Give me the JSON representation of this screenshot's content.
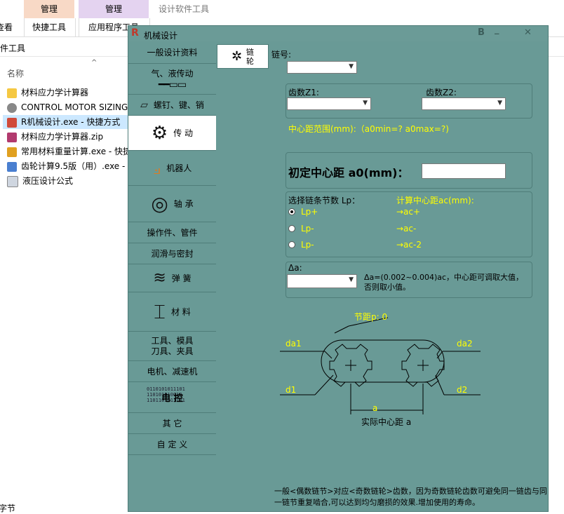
{
  "explorer": {
    "ribbon_tabs": [
      "管理",
      "管理"
    ],
    "ribbon_title": "设计软件工具",
    "ribbon_row": [
      "查看",
      "快捷工具",
      "应用程序工具"
    ],
    "address": "件工具",
    "column_name": "名称",
    "files": [
      "材料应力学计算器",
      "CONTROL MOTOR SIZING",
      "R机械设计.exe - 快捷方式",
      "材料应力学计算器.zip",
      "常用材料重量计算.exe - 快捷",
      "齿轮计算9.5版（用）.exe - ",
      "液压设计公式"
    ],
    "bottom_text": "字节"
  },
  "app": {
    "title": "机械设计",
    "title_controls": [
      "B",
      "_",
      "✕"
    ],
    "nav": [
      "一般设计资料",
      "气、液传动",
      "螺钉、键、销",
      "传 动",
      "机器人",
      "轴 承",
      "操作件、管件",
      "润滑与密封",
      "弹 簧",
      "材 料",
      "工具、模具\n刀具、夹具",
      "电机、减速机",
      "电 控",
      "其 它",
      "自 定 义"
    ],
    "subtab": "链\n轮",
    "chain_no_label": "链号:",
    "z1_label": "齿数Z1:",
    "z2_label": "齿数Z2:",
    "center_range": "中心距范围(mm):（a0min=?     a0max=?)",
    "a0_label": "初定中心距 a0(mm)：",
    "lp_label": "选择链条节数 Lp：",
    "ac_label": "计算中心距ac(mm):",
    "lp_options": [
      "Lp+",
      "Lp-",
      "Lp-"
    ],
    "ac_options": [
      "→ac+",
      "→ac-",
      "→ac-2"
    ],
    "delta_label": "Δa:",
    "delta_note": "Δa=(0.002~0.004)ac，中心距可调取大值，否则取小值。",
    "pitch_label": "节距p:  0",
    "da1": "da1",
    "da2": "da2",
    "d1": "d1",
    "d2": "d2",
    "a_label": "a",
    "actual_center": "实际中心距 a",
    "footnote": "一般<偶数链节>对应<奇数链轮>齿数，因为奇数链轮齿数可避免同一链齿与同一链节重复啮合,可以达到均匀磨损的效果.增加使用的寿命。",
    "colors": {
      "window_bg": "#699a96",
      "highlight": "#ffff00"
    }
  }
}
